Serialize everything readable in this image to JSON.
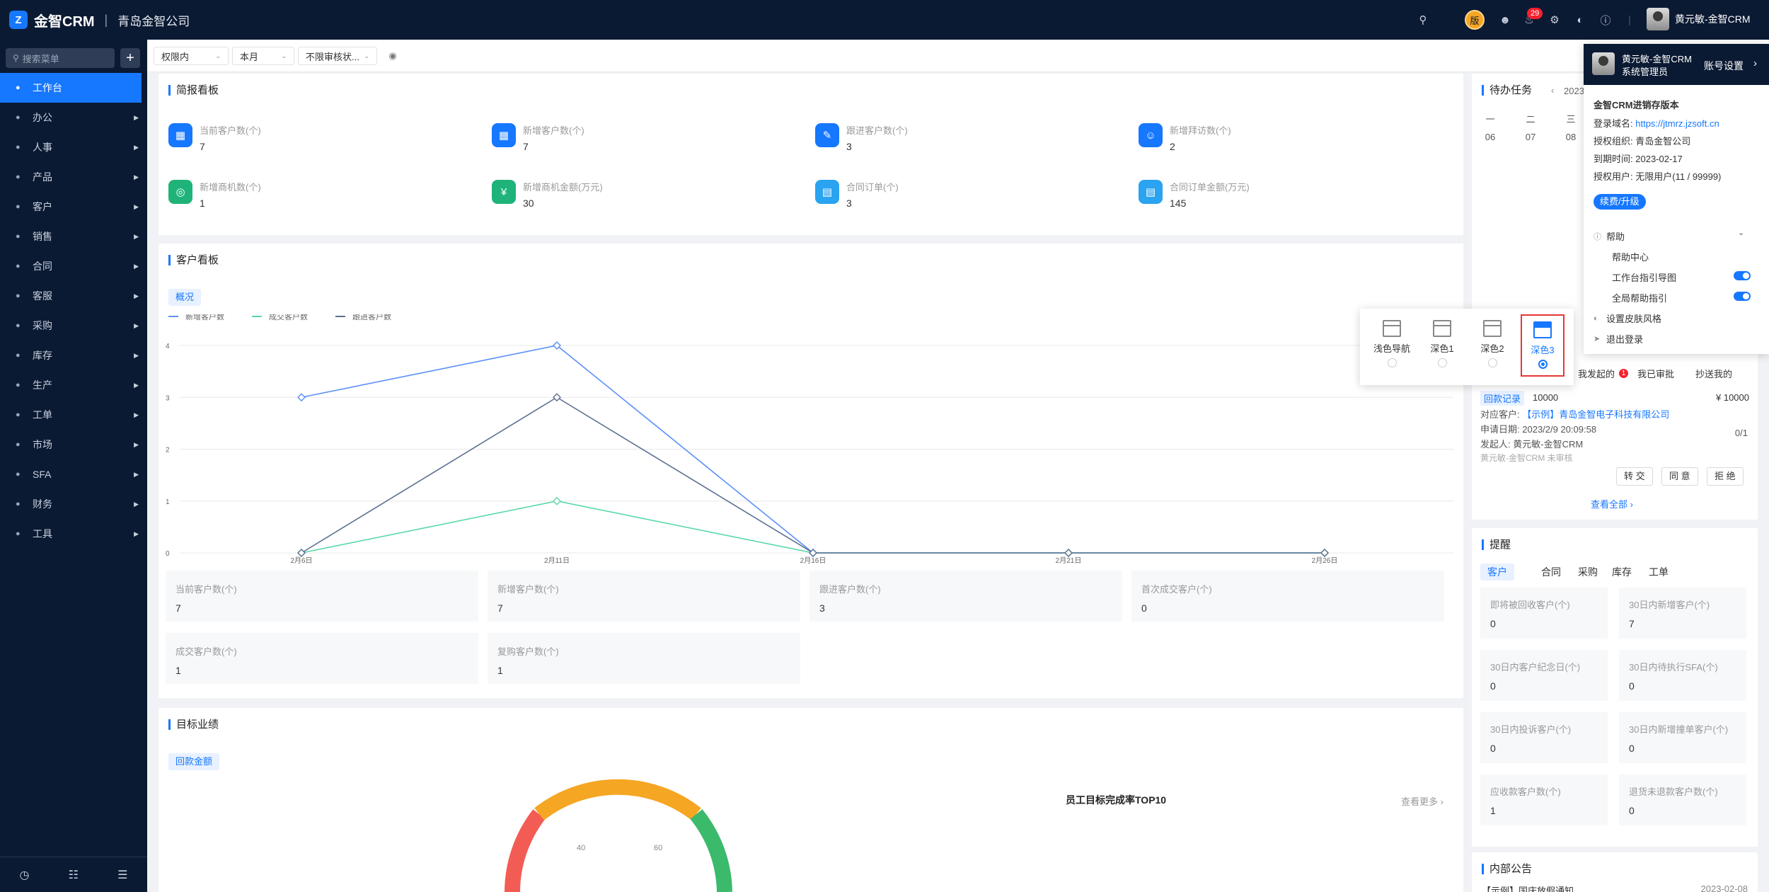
{
  "header": {
    "logo_letter": "Z",
    "app_name": "金智CRM",
    "separator": "|",
    "company": "青岛金智公司",
    "notification_count": "29",
    "version_icon": "版",
    "user": "黄元敏-金智CRM"
  },
  "sidebar": {
    "search_placeholder": "搜索菜单",
    "add_label": "+",
    "items": [
      {
        "label": "工作台",
        "active": true
      },
      {
        "label": "办公"
      },
      {
        "label": "人事"
      },
      {
        "label": "产品"
      },
      {
        "label": "客户"
      },
      {
        "label": "销售"
      },
      {
        "label": "合同"
      },
      {
        "label": "客服"
      },
      {
        "label": "采购"
      },
      {
        "label": "库存"
      },
      {
        "label": "生产"
      },
      {
        "label": "工单"
      },
      {
        "label": "市场"
      },
      {
        "label": "SFA"
      },
      {
        "label": "财务"
      },
      {
        "label": "工具"
      }
    ]
  },
  "filters": {
    "scope": "权限内",
    "period": "本月",
    "audit": "不限审核状..."
  },
  "brief_board": {
    "title": "简报看板",
    "stats": [
      {
        "label": "当前客户数(个)",
        "value": "7",
        "color": "#1677ff",
        "icon": "building-icon"
      },
      {
        "label": "新增客户数(个)",
        "value": "7",
        "color": "#1677ff",
        "icon": "building-add-icon"
      },
      {
        "label": "跟进客户数(个)",
        "value": "3",
        "color": "#1677ff",
        "icon": "edit-icon"
      },
      {
        "label": "新增拜访数(个)",
        "value": "2",
        "color": "#1677ff",
        "icon": "users-icon"
      },
      {
        "label": "新增商机数(个)",
        "value": "1",
        "color": "#1fb37a",
        "icon": "target-icon"
      },
      {
        "label": "新增商机金额(万元)",
        "value": "30",
        "color": "#1fb37a",
        "icon": "money-icon"
      },
      {
        "label": "合同订单(个)",
        "value": "3",
        "color": "#2aa3f0",
        "icon": "contract-icon"
      },
      {
        "label": "合同订单金额(万元)",
        "value": "145",
        "color": "#2aa3f0",
        "icon": "order-money-icon"
      }
    ]
  },
  "customer_board": {
    "title": "客户看板",
    "tab": "概况",
    "boxes": [
      {
        "label": "当前客户数(个)",
        "value": "7"
      },
      {
        "label": "新增客户数(个)",
        "value": "7"
      },
      {
        "label": "跟进客户数(个)",
        "value": "3"
      },
      {
        "label": "首次成交客户(个)",
        "value": "0"
      },
      {
        "label": "成交客户数(个)",
        "value": "1"
      },
      {
        "label": "复购客户数(个)",
        "value": "1"
      }
    ]
  },
  "chart_data": {
    "type": "line",
    "x": [
      "2月6日",
      "2月11日",
      "2月16日",
      "2月21日",
      "2月26日"
    ],
    "ylim": [
      0,
      4
    ],
    "yticks": [
      "0",
      "1",
      "2",
      "3",
      "4"
    ],
    "grid": true,
    "legend": "top-left",
    "series": [
      {
        "name": "新增客户数",
        "color": "#5b8ff9",
        "values": [
          3,
          4,
          0,
          0,
          0
        ]
      },
      {
        "name": "成交客户数",
        "color": "#5ad8a6",
        "values": [
          0,
          1,
          0,
          0,
          0
        ]
      },
      {
        "name": "跟进客户数",
        "color": "#5d7092",
        "values": [
          0,
          3,
          0,
          0,
          0
        ]
      }
    ]
  },
  "target_board": {
    "title": "目标业绩",
    "tab": "回款金额",
    "top10_title": "员工目标完成率TOP10",
    "more": "查看更多 ›",
    "gauge_ticks": [
      "40",
      "60"
    ]
  },
  "todo": {
    "title": "待办任务",
    "year_prefix": "2023",
    "weekdays": [
      "一",
      "二",
      "三"
    ],
    "days": [
      "06",
      "07",
      "08"
    ],
    "approval_tabs": [
      "我发起的",
      "我已审批",
      "抄送我的"
    ],
    "approval_badge": "1",
    "record": {
      "tag": "回款记录",
      "number": "10000",
      "amount": "¥ 10000",
      "customer_label": "对应客户:",
      "customer": "【示例】青岛金智电子科技有限公司",
      "date_label": "申请日期:",
      "date": "2023/2/9 20:09:58",
      "count": "0/1",
      "initiator_label": "发起人:",
      "initiator": "黄元敏-金智CRM",
      "status": "黄元敏-金智CRM 未审核"
    },
    "buttons": [
      "转 交",
      "同 意",
      "拒 绝"
    ],
    "view_all": "查看全部 ›"
  },
  "reminder": {
    "title": "提醒",
    "tabs": [
      "客户",
      "合同",
      "采购",
      "库存",
      "工单"
    ],
    "items": [
      {
        "label": "即将被回收客户(个)",
        "value": "0"
      },
      {
        "label": "30日内新增客户(个)",
        "value": "7"
      },
      {
        "label": "30日内客户纪念日(个)",
        "value": "0"
      },
      {
        "label": "30日内待执行SFA(个)",
        "value": "0"
      },
      {
        "label": "30日内投诉客户(个)",
        "value": "0"
      },
      {
        "label": "30日内新增撞单客户(个)",
        "value": "0"
      },
      {
        "label": "应收款客户数(个)",
        "value": "1"
      },
      {
        "label": "退货未退款客户数(个)",
        "value": "0"
      }
    ]
  },
  "notice": {
    "title": "内部公告",
    "item": "【示例】国庆放假通知",
    "date": "2023-02-08"
  },
  "account_popup": {
    "name": "黄元敏-金智CRM",
    "role": "系统管理员",
    "settings": "账号设置",
    "arrow": "›",
    "edition": "金智CRM进销存版本",
    "domain_label": "登录域名:",
    "domain": "https://jtmrz.jzsoft.cn",
    "org_label": "授权组织:",
    "org": "青岛金智公司",
    "expire_label": "到期时间:",
    "expire": "2023-02-17",
    "users_label": "授权用户:",
    "users": "无限用户(11 / 99999)",
    "upgrade": "续费/升级",
    "help": "帮助",
    "help_center": "帮助中心",
    "guide": "工作台指引导图",
    "global_help": "全局帮助指引",
    "skin": "设置皮肤风格",
    "logout": "退出登录"
  },
  "skin_picker": {
    "options": [
      "浅色导航",
      "深色1",
      "深色2",
      "深色3"
    ],
    "selected": "深色3"
  }
}
